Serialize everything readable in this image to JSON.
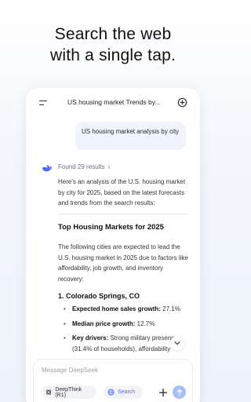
{
  "headline": {
    "line1": "Search the web",
    "line2": "with a single tap."
  },
  "topbar": {
    "chat_title": "US housing market Trends by..."
  },
  "user_message": "US housing market analysis by city",
  "response": {
    "found_results": "Found 29 results",
    "intro": "Here's an analysis of the U.S. housing market by city for 2025, based on the latest forecasts and trends from the search results:",
    "section_title": "Top Housing Markets for 2025",
    "section_body": "The following cities are expected to lead the U.S. housing market in 2025 due to factors like affordability, job growth, and inventory recovery:",
    "city_heading": "1. Colorado Springs, CO",
    "bullets": [
      {
        "label": "Expected home sales growth:",
        "value": " 27.1%"
      },
      {
        "label": "Median price growth:",
        "value": " 12.7%"
      },
      {
        "label": "Key drivers:",
        "value": " Strong military presence (31.4% of households), affordability"
      }
    ]
  },
  "composer": {
    "placeholder": "Message DeepSeek",
    "deepthink_label": "DeepThink (R1)",
    "search_label": "Search"
  },
  "colors": {
    "accent": "#4d6bfe",
    "send_disabled": "#a5bff2",
    "bubble": "#eff4fd"
  }
}
